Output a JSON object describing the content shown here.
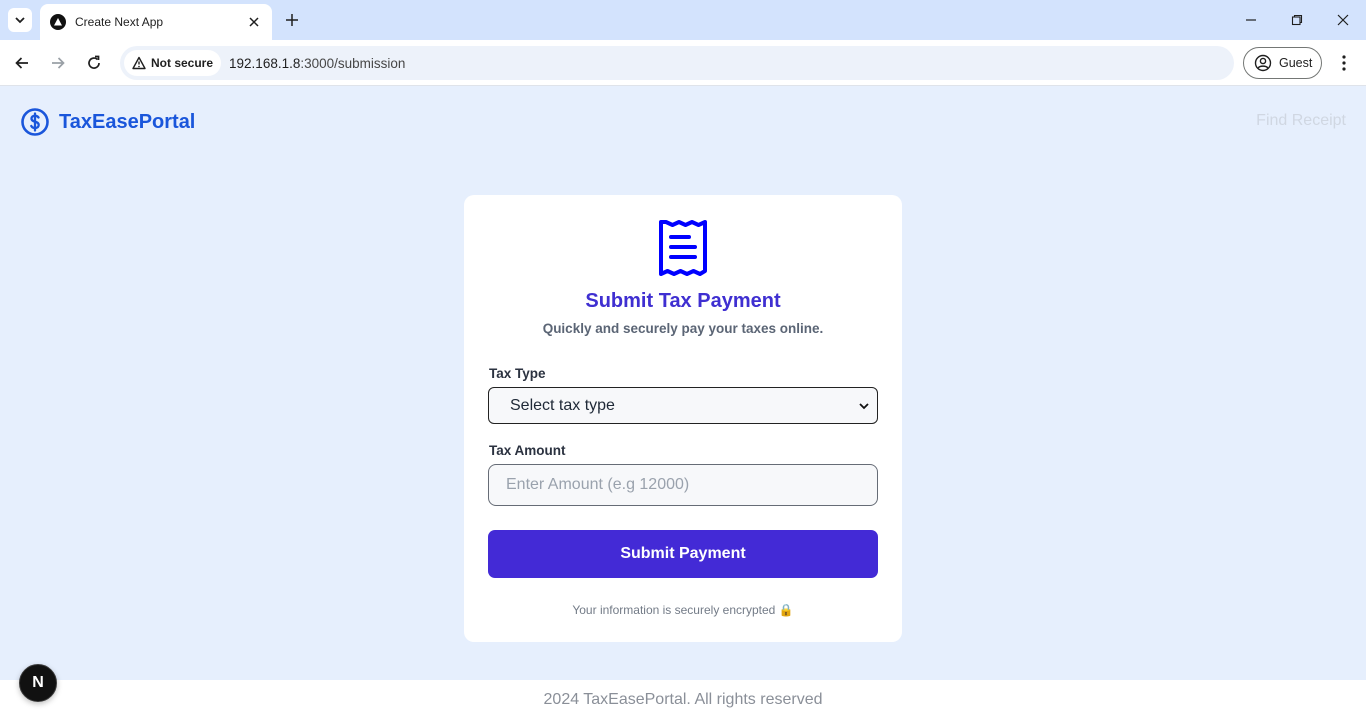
{
  "browser": {
    "tab_title": "Create Next App",
    "security_label": "Not secure",
    "url_host": "192.168.1.8",
    "url_path": ":3000/submission",
    "profile_label": "Guest"
  },
  "header": {
    "brand_name": "TaxEasePortal",
    "find_receipt_label": "Find Receipt"
  },
  "card": {
    "title": "Submit Tax Payment",
    "subtitle": "Quickly and securely pay your taxes online.",
    "tax_type_label": "Tax Type",
    "tax_type_selected": "Select tax type",
    "tax_amount_label": "Tax Amount",
    "tax_amount_placeholder": "Enter Amount (e.g 12000)",
    "submit_label": "Submit Payment",
    "secure_note": "Your information is securely encrypted 🔒"
  },
  "footer": {
    "text": "2024 TaxEasePortal. All rights reserved"
  },
  "dev": {
    "badge_letter": "N"
  },
  "colors": {
    "brand_blue": "#1a56db",
    "accent_purple": "#432ad6",
    "page_bg": "#e6effd",
    "icon_blue": "#0000ff"
  },
  "icons": [
    "tab-list-icon",
    "nextjs-favicon-icon",
    "close-icon",
    "plus-icon",
    "minimize-icon",
    "restore-icon",
    "close-window-icon",
    "back-arrow-icon",
    "forward-arrow-icon",
    "reload-icon",
    "warning-icon",
    "profile-icon",
    "kebab-menu-icon",
    "dollar-circle-icon",
    "receipt-icon",
    "chevron-down-icon"
  ]
}
